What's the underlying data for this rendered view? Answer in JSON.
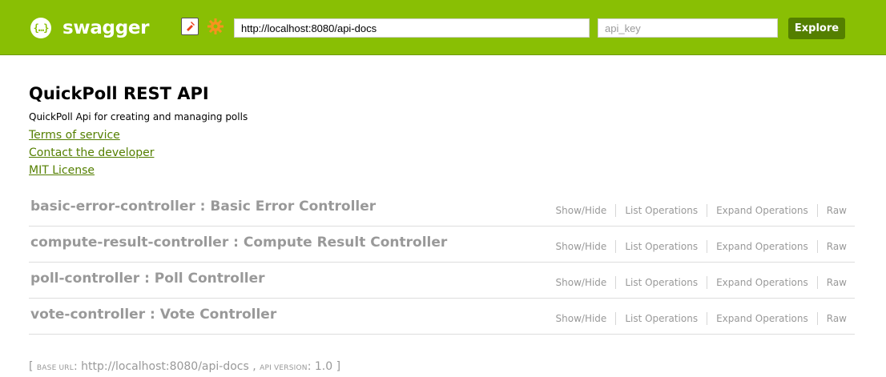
{
  "header": {
    "logo_mark": "{…}",
    "logo_text": "swagger",
    "url_value": "http://localhost:8080/api-docs",
    "api_key_placeholder": "api_key",
    "explore_label": "Explore",
    "bar_color": "#89bf04",
    "button_color": "#547f00",
    "icons": [
      "edit-icon",
      "gear-icon"
    ]
  },
  "info": {
    "title": "QuickPoll REST API",
    "description": "QuickPoll Api for creating and managing polls",
    "links": [
      {
        "label": "Terms of service"
      },
      {
        "label": "Contact the developer"
      },
      {
        "label": "MIT License"
      }
    ],
    "link_color": "#547f00"
  },
  "resources": [
    {
      "name": "basic-error-controller : Basic Error Controller"
    },
    {
      "name": "compute-result-controller : Compute Result Controller"
    },
    {
      "name": "poll-controller : Poll Controller"
    },
    {
      "name": "vote-controller : Vote Controller"
    }
  ],
  "operations": {
    "show_hide": "Show/Hide",
    "list": "List Operations",
    "expand": "Expand Operations",
    "raw": "Raw"
  },
  "footer": {
    "open": "[ ",
    "base_url_label": "Base URL",
    "base_url_value": ": http://localhost:8080/api-docs , ",
    "api_version_label": "API Version",
    "api_version_value": ": 1.0 ]"
  }
}
